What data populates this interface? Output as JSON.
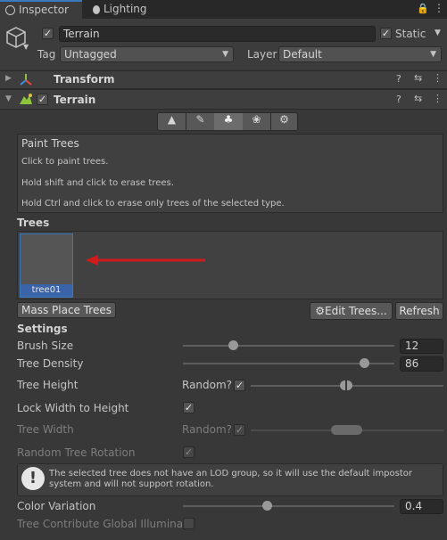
{
  "tabs": {
    "inspector": "Inspector",
    "lighting": "Lighting"
  },
  "object": {
    "name": "Terrain",
    "static_label": "Static",
    "tag_label": "Tag",
    "tag_value": "Untagged",
    "layer_label": "Layer",
    "layer_value": "Default"
  },
  "components": {
    "transform": "Transform",
    "terrain": "Terrain"
  },
  "paint_trees": {
    "title": "Paint Trees",
    "line1": "Click to paint trees.",
    "line2": "Hold shift and click to erase trees.",
    "line3": "Hold Ctrl and click to erase only trees of the selected type."
  },
  "trees": {
    "heading": "Trees",
    "items": [
      "tree01"
    ]
  },
  "buttons": {
    "mass_place": "Mass Place Trees",
    "edit_trees": "Edit Trees...",
    "refresh": "Refresh"
  },
  "settings": {
    "heading": "Settings",
    "brush_size": {
      "label": "Brush Size",
      "value": "12",
      "fraction": 0.24
    },
    "tree_density": {
      "label": "Tree Density",
      "value": "86",
      "fraction": 0.86
    },
    "tree_height": {
      "label": "Tree Height",
      "random_label": "Random?",
      "random_checked": true
    },
    "lock_width": {
      "label": "Lock Width to Height",
      "checked": true
    },
    "tree_width": {
      "label": "Tree Width",
      "random_label": "Random?"
    },
    "random_rotation": {
      "label": "Random Tree Rotation"
    },
    "warning": "The selected tree does not have an LOD group, so it will use the default impostor system and will not support rotation.",
    "color_variation": {
      "label": "Color Variation",
      "value": "0.4",
      "fraction": 0.4
    },
    "global_illumination": {
      "label": "Tree Contribute Global Illuminatio"
    }
  }
}
